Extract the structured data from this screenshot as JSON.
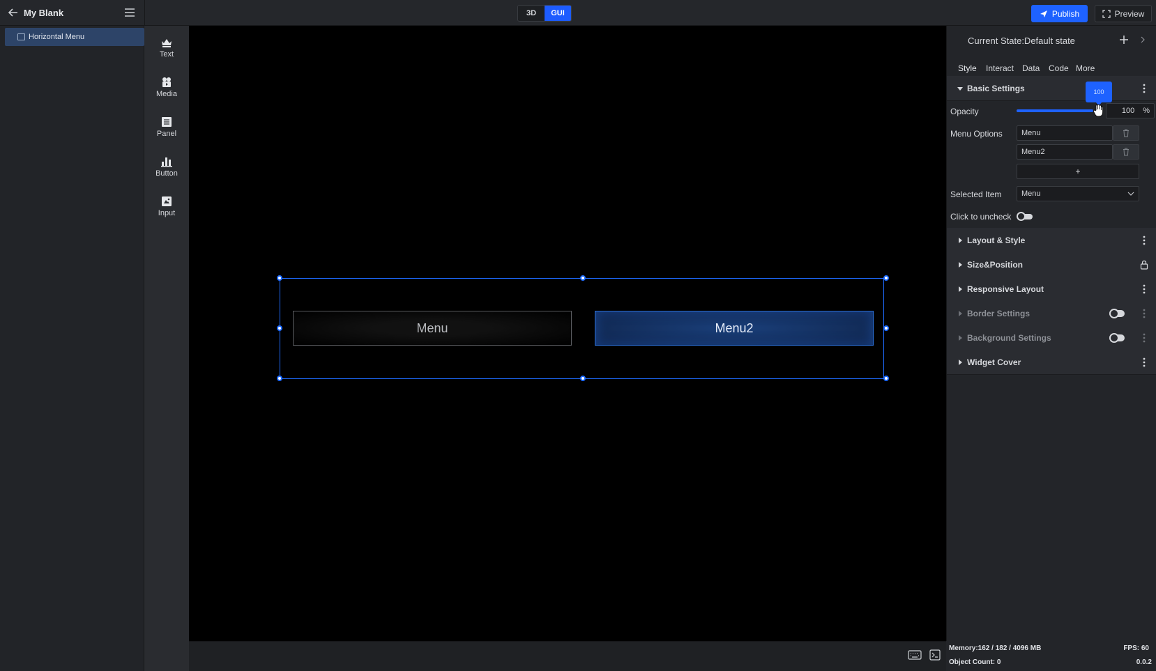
{
  "header": {
    "project_title": "My Blank",
    "mode_3d": "3D",
    "mode_gui": "GUI",
    "publish_label": "Publish",
    "preview_label": "Preview"
  },
  "layers": {
    "items": [
      {
        "label": "Horizontal Menu",
        "selected": true
      }
    ]
  },
  "toolbox": {
    "items": [
      {
        "label": "Text",
        "icon": "text-icon"
      },
      {
        "label": "Media",
        "icon": "media-icon"
      },
      {
        "label": "Panel",
        "icon": "panel-icon"
      },
      {
        "label": "Button",
        "icon": "button-icon"
      },
      {
        "label": "Input",
        "icon": "input-icon"
      }
    ]
  },
  "canvas": {
    "menu_items": [
      {
        "label": "Menu",
        "selected": false
      },
      {
        "label": "Menu2",
        "selected": true
      }
    ]
  },
  "properties": {
    "state_title": "Current State:Default state",
    "tabs": [
      "Style",
      "Interact",
      "Data",
      "Code",
      "More"
    ],
    "active_tab": "Style",
    "sections": {
      "basic": "Basic Settings",
      "layout": "Layout & Style",
      "size": "Size&Position",
      "responsive": "Responsive Layout",
      "border": "Border Settings",
      "background": "Background Settings",
      "cover": "Widget Cover"
    },
    "basic": {
      "opacity_label": "Opacity",
      "opacity_value": "100",
      "opacity_tooltip": "100",
      "opacity_unit": "%",
      "opacity_fraction": 1.0,
      "menu_options_label": "Menu Options",
      "menu_options": [
        "Menu",
        "Menu2"
      ],
      "add_option_label": "+",
      "selected_item_label": "Selected Item",
      "selected_item_value": "Menu",
      "click_uncheck_label": "Click to uncheck",
      "click_uncheck_on": false
    }
  },
  "status": {
    "memory": "Memory:162 / 182 / 4096 MB",
    "fps": "FPS: 60",
    "object_count": "Object Count: 0",
    "version": "0.0.2"
  },
  "colors": {
    "accent": "#1e62ff",
    "panel_bg": "#232529",
    "canvas_bg": "#000000"
  }
}
